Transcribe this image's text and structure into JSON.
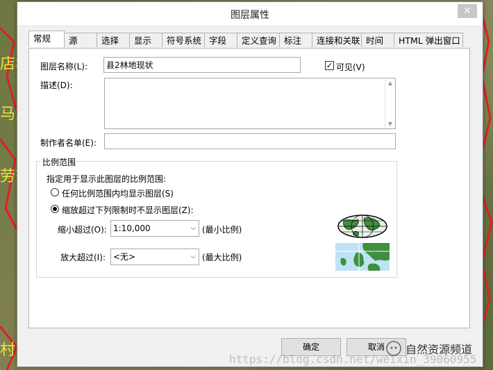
{
  "background": {
    "labels": [
      "店村",
      "马刘",
      "劳寄",
      "村"
    ]
  },
  "dialog": {
    "title": "图层属性",
    "close_icon": "close-icon"
  },
  "tabs": [
    {
      "label": "常规",
      "active": true
    },
    {
      "label": "源"
    },
    {
      "label": "选择"
    },
    {
      "label": "显示"
    },
    {
      "label": "符号系统"
    },
    {
      "label": "字段"
    },
    {
      "label": "定义查询"
    },
    {
      "label": "标注"
    },
    {
      "label": "连接和关联"
    },
    {
      "label": "时间"
    },
    {
      "label": "HTML 弹出窗口"
    }
  ],
  "general": {
    "layer_name_label": "图层名称(L):",
    "layer_name_value": "县2林地现状",
    "visible_label": "可见(V)",
    "visible_checked": true,
    "description_label": "描述(D):",
    "description_value": "",
    "credits_label": "制作者名单(E):",
    "credits_value": ""
  },
  "scale_range": {
    "group_title": "比例范围",
    "prompt": "指定用于显示此图层的比例范围:",
    "option_any_label": "任何比例范围内均显示图层(S)",
    "option_limit_label": "缩放超过下列限制时不显示图层(Z):",
    "selected": "limit",
    "min_scale_label": "缩小超过(O):",
    "min_scale_value": "1:10,000",
    "min_scale_hint": "(最小比例)",
    "max_scale_label": "放大超过(I):",
    "max_scale_value": "<无>",
    "max_scale_hint": "(最大比例)"
  },
  "buttons": {
    "ok": "确定",
    "cancel": "取消"
  },
  "watermark": "https://blog.csdn.net/weixin_39060955",
  "brand": {
    "name": "自然资源频道"
  }
}
